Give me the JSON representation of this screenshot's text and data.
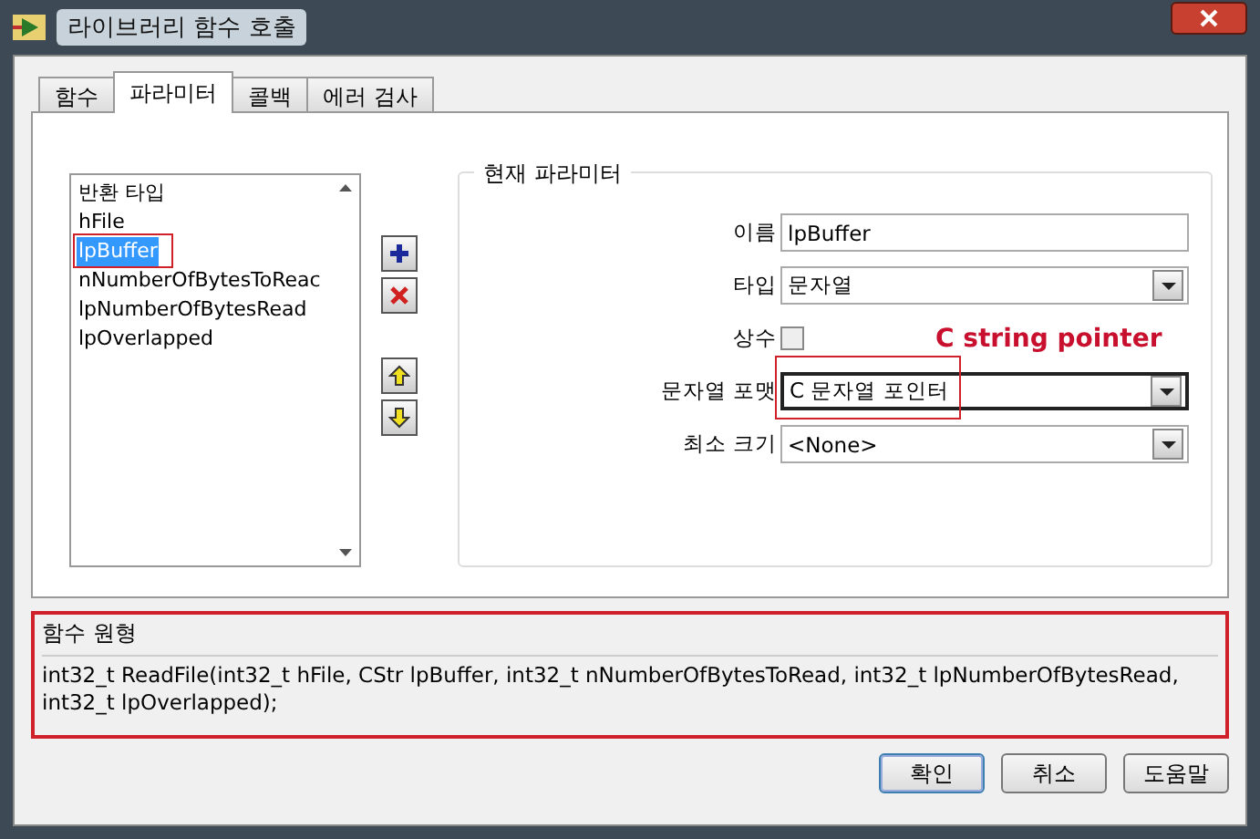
{
  "window": {
    "title": "라이브러리 함수 호출"
  },
  "tabs": [
    {
      "label": "함수",
      "selected": false
    },
    {
      "label": "파라미터",
      "selected": true
    },
    {
      "label": "콜백",
      "selected": false
    },
    {
      "label": "에러 검사",
      "selected": false
    }
  ],
  "parameter_list": {
    "items": [
      {
        "label": "반환 타입",
        "selected": false
      },
      {
        "label": "hFile",
        "selected": false
      },
      {
        "label": "lpBuffer",
        "selected": true
      },
      {
        "label": "nNumberOfBytesToReac",
        "selected": false
      },
      {
        "label": "lpNumberOfBytesRead",
        "selected": false
      },
      {
        "label": "lpOverlapped",
        "selected": false
      }
    ]
  },
  "current_parameter": {
    "title": "현재 파라미터",
    "fields": [
      {
        "kind": "text",
        "label": "이름",
        "value": "lpBuffer"
      },
      {
        "kind": "dropdown",
        "label": "타입",
        "value": "문자열"
      },
      {
        "kind": "checkbox",
        "label": "상수",
        "checked": false
      },
      {
        "kind": "dropdown",
        "label": "문자열 포맷",
        "value": "C 문자열 포인터",
        "focused": true
      },
      {
        "kind": "dropdown",
        "label": "최소 크기",
        "value": "<None>"
      }
    ]
  },
  "annotation": {
    "text": "C string pointer"
  },
  "prototype": {
    "title": "함수 원형",
    "text": "int32_t ReadFile(int32_t hFile, CStr lpBuffer, int32_t nNumberOfBytesToRead, int32_t lpNumberOfBytesRead, int32_t lpOverlapped);"
  },
  "buttons": [
    {
      "label": "확인",
      "default": true
    },
    {
      "label": "취소",
      "default": false
    },
    {
      "label": "도움말",
      "default": false
    }
  ]
}
